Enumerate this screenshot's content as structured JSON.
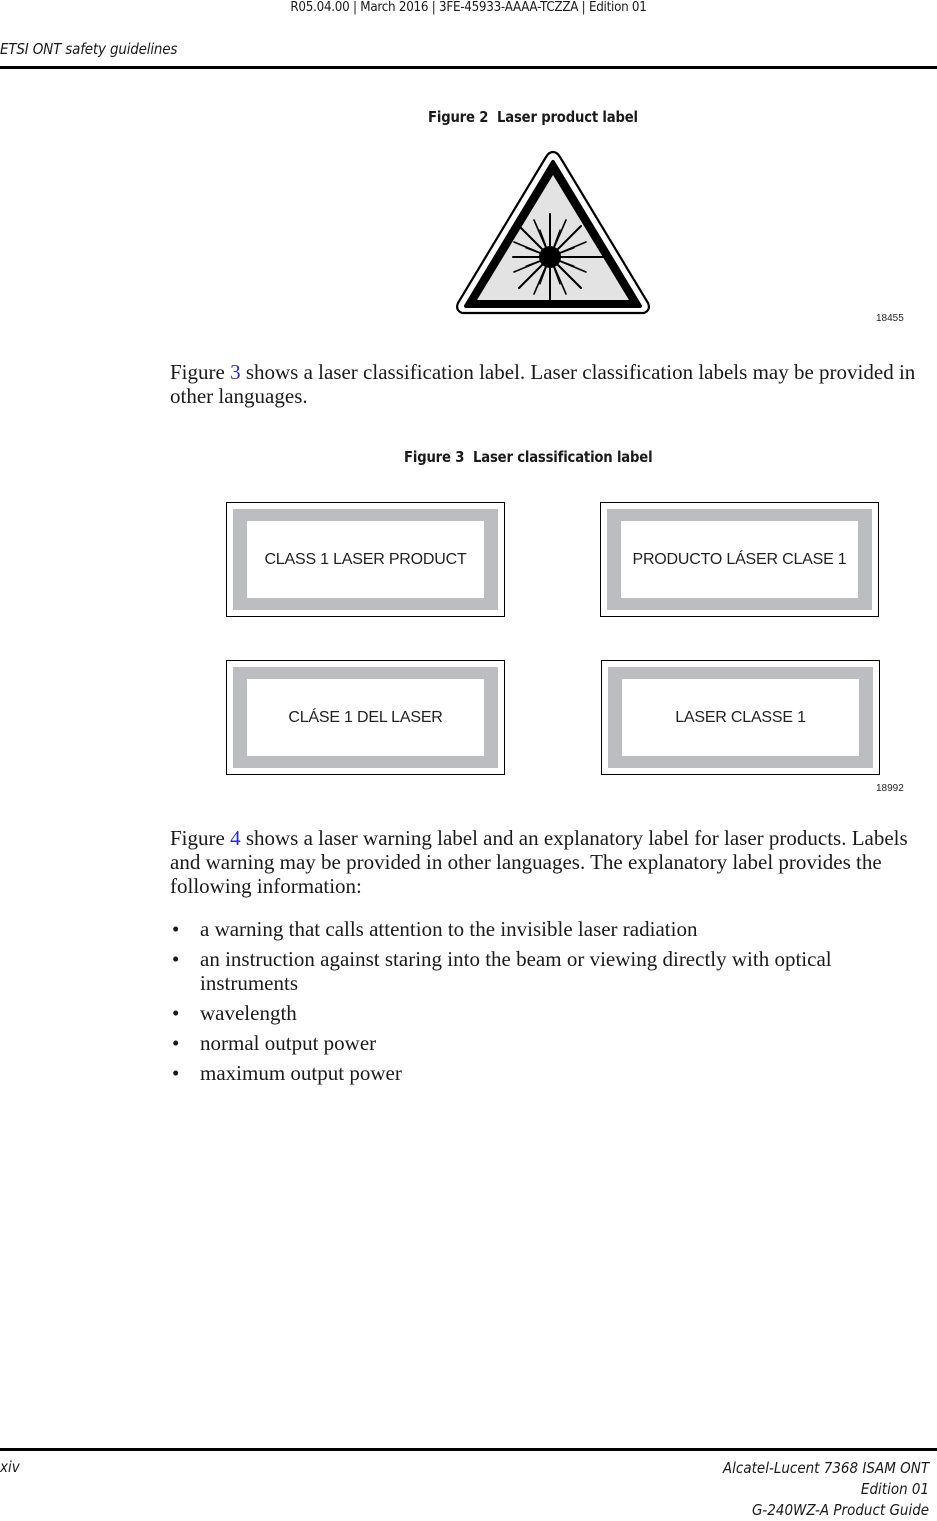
{
  "header": {
    "meta": "R05.04.00 | March 2016 | 3FE-45933-AAAA-TCZZA | Edition 01",
    "section_title": "ETSI ONT safety guidelines"
  },
  "figure2": {
    "number": "Figure 2",
    "title": "Laser product label",
    "graphic_id": "18455",
    "icon": "laser-warning-icon"
  },
  "paragraph1": {
    "before_link": "Figure ",
    "link_text": "3",
    "after_link": " shows a laser classification label. Laser classification labels may be provided in other languages."
  },
  "figure3": {
    "number": "Figure 3",
    "title": "Laser classification label",
    "graphic_id": "18992",
    "labels": [
      "CLASS 1 LASER PRODUCT",
      "PRODUCTO LÁSER CLASE 1",
      "CLÁSE 1 DEL LASER",
      "LASER CLASSE 1"
    ],
    "colors": {
      "frame_gray": "#bcbdc1",
      "border": "#000000"
    }
  },
  "paragraph2": {
    "before_link": "Figure ",
    "link_text": "4",
    "after_link": " shows a laser warning label and an explanatory label for laser products. Labels and warning may be provided in other languages. The explanatory label provides the following information:"
  },
  "bullets": [
    "a warning that calls attention to the invisible laser radiation",
    "an instruction against staring into the beam or viewing directly with optical instruments",
    "wavelength",
    "normal output power",
    "maximum output power"
  ],
  "footer": {
    "page_number": "xiv",
    "product": "Alcatel-Lucent 7368 ISAM ONT",
    "edition": "Edition 01",
    "guide": "G-240WZ-A Product Guide"
  },
  "colors": {
    "link": "#2b2bd6"
  }
}
